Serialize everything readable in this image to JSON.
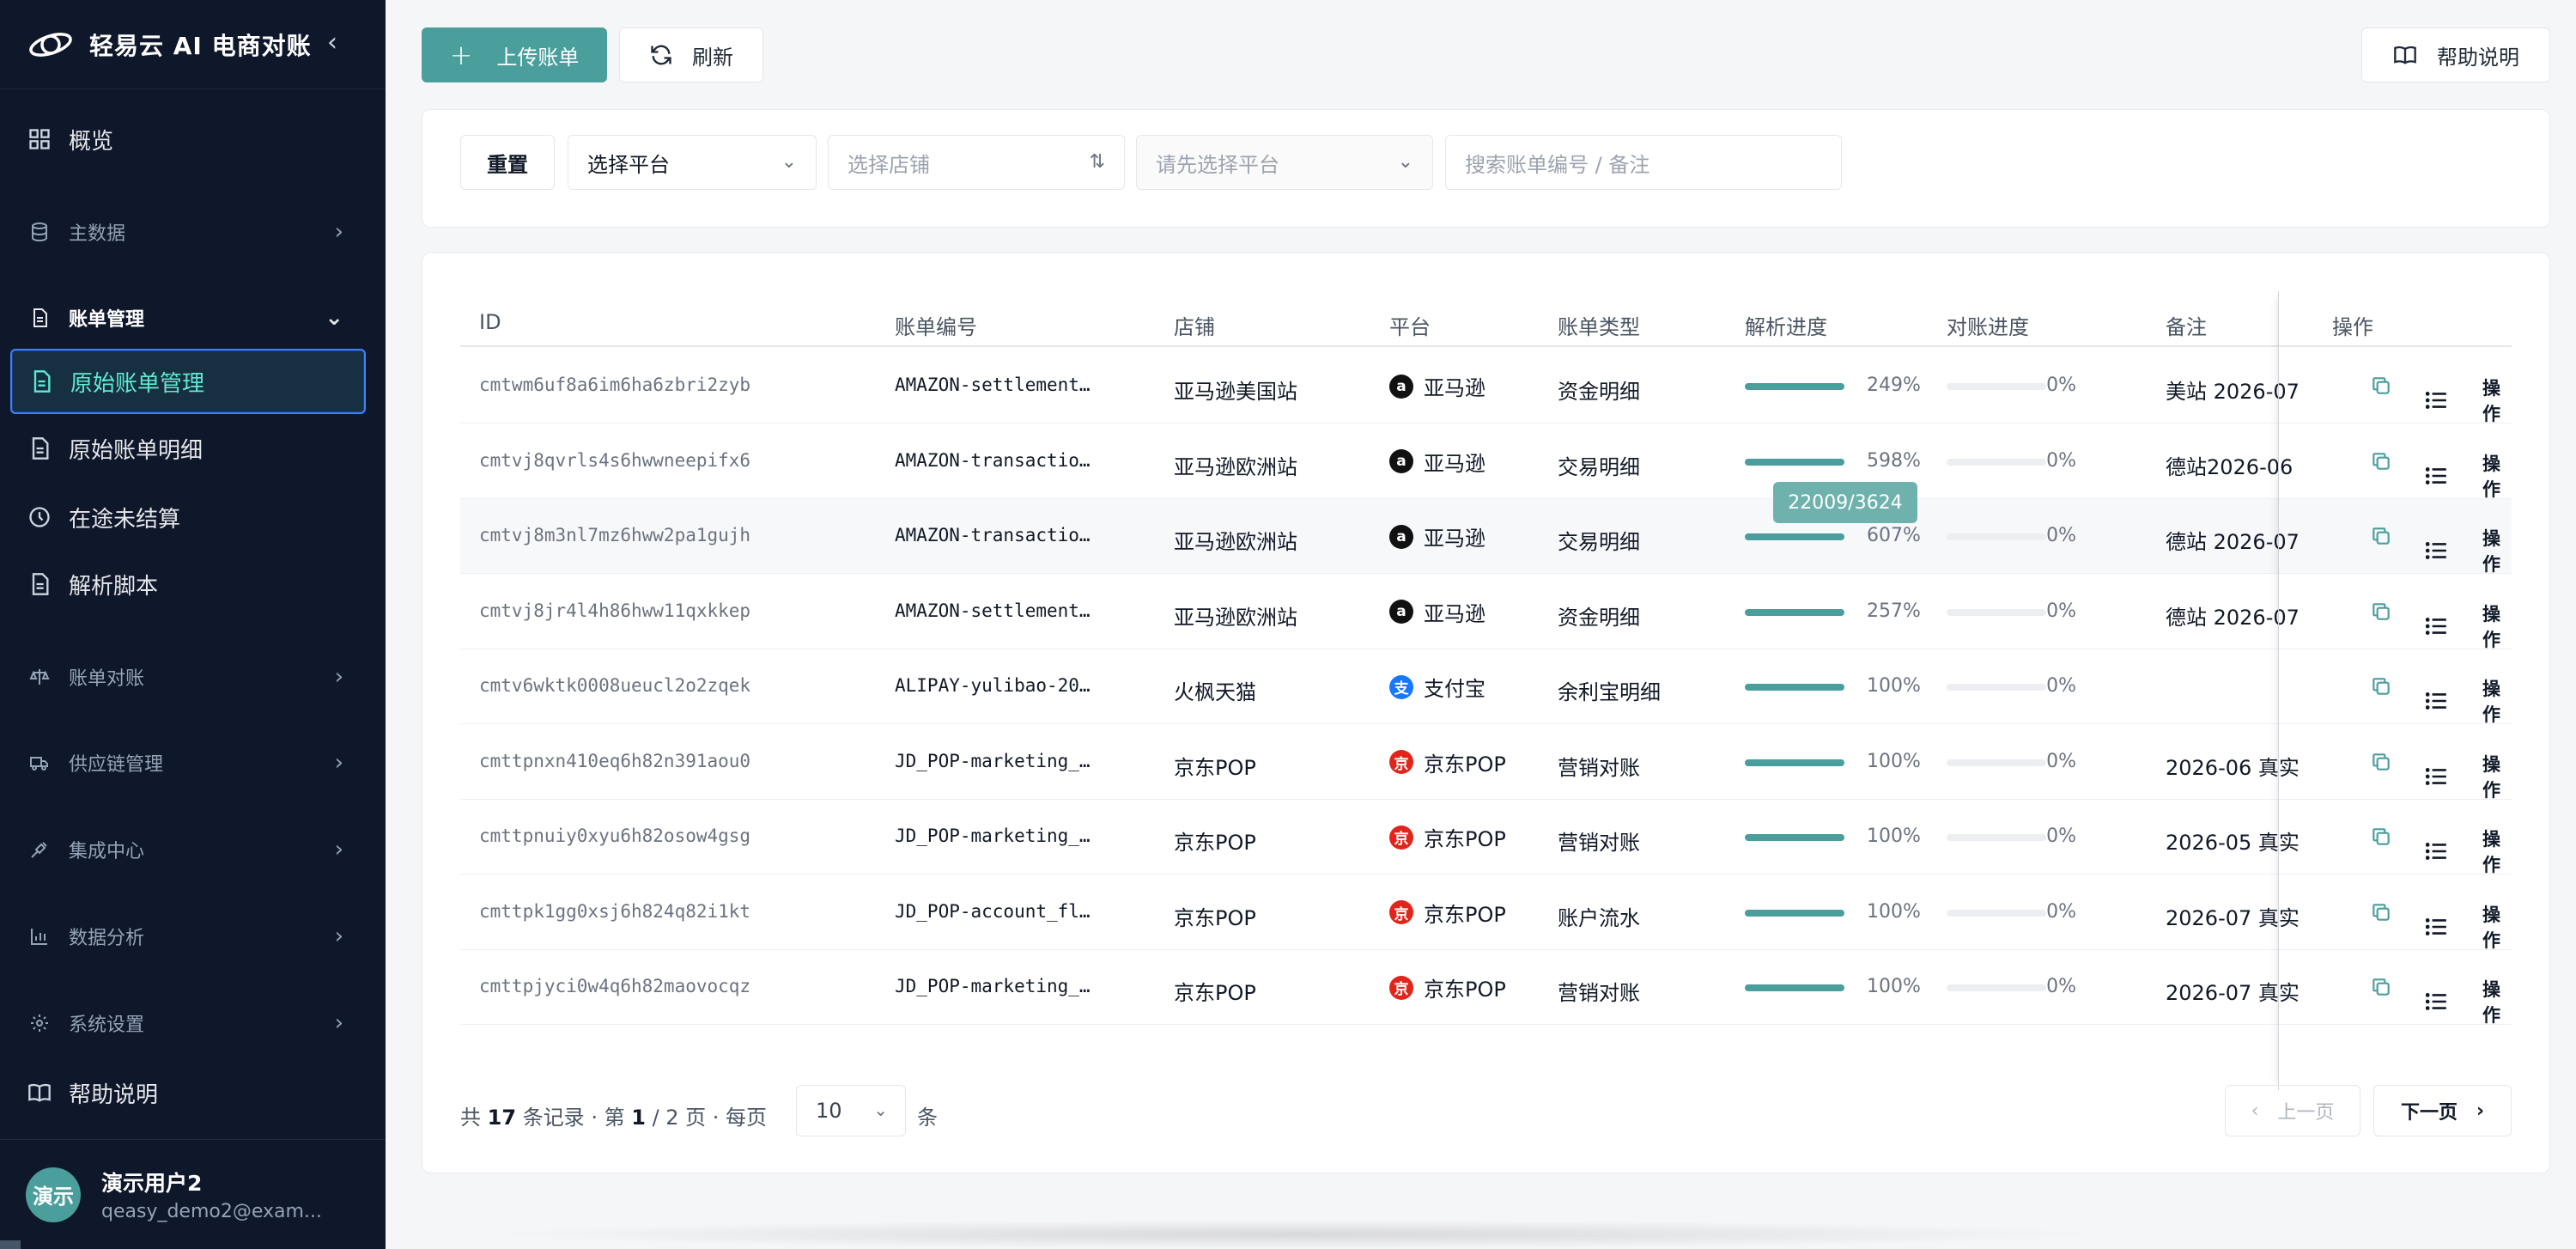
{
  "brand": {
    "title": "轻易云 AI 电商对账",
    "collapse_icon": "chevron-left-icon"
  },
  "nav": {
    "overview": "概览",
    "master_data": "主数据",
    "bill_mgmt": "账单管理",
    "raw_bills": "原始账单管理",
    "raw_details": "原始账单明细",
    "in_transit": "在途未结算",
    "parse_script": "解析脚本",
    "reconcile": "账单对账",
    "supply_chain": "供应链管理",
    "integration": "集成中心",
    "analytics": "数据分析",
    "settings": "系统设置",
    "help": "帮助说明"
  },
  "user": {
    "avatar_text": "演示",
    "name": "演示用户2",
    "email": "qeasy_demo2@exam..."
  },
  "toolbar": {
    "upload": "上传账单",
    "refresh": "刷新",
    "help": "帮助说明"
  },
  "filters": {
    "reset": "重置",
    "platform": "选择平台",
    "shop_placeholder": "选择店铺",
    "sub_placeholder": "请先选择平台",
    "search_placeholder": "搜索账单编号 / 备注"
  },
  "table": {
    "headers": {
      "id": "ID",
      "no": "账单编号",
      "shop": "店铺",
      "platform": "平台",
      "type": "账单类型",
      "parse": "解析进度",
      "reconcile": "对账进度",
      "note": "备注",
      "ops": "操作"
    },
    "op_label": "操作",
    "rows": [
      {
        "id": "cmtwm6uf8a6im6ha6zbri2zyb",
        "no": "AMAZON-settlement…",
        "shop": "亚马逊美国站",
        "platform": "亚马逊",
        "platform_key": "amazon",
        "type": "资金明细",
        "parse_pct": "249%",
        "parse_frac": 1.0,
        "rec_pct": "0%",
        "rec_frac": 0,
        "note": "美站 2026-07"
      },
      {
        "id": "cmtvj8qvrls4s6hwwneepifx6",
        "no": "AMAZON-transactio…",
        "shop": "亚马逊欧洲站",
        "platform": "亚马逊",
        "platform_key": "amazon",
        "type": "交易明细",
        "parse_pct": "598%",
        "parse_frac": 1.0,
        "rec_pct": "0%",
        "rec_frac": 0,
        "note": "德站2026-06"
      },
      {
        "id": "cmtvj8m3nl7mz6hww2pa1gujh",
        "no": "AMAZON-transactio…",
        "shop": "亚马逊欧洲站",
        "platform": "亚马逊",
        "platform_key": "amazon",
        "type": "交易明细",
        "parse_pct": "607%",
        "parse_frac": 1.0,
        "rec_pct": "0%",
        "rec_frac": 0,
        "note": "德站 2026-07"
      },
      {
        "id": "cmtvj8jr4l4h86hww11qxkkep",
        "no": "AMAZON-settlement…",
        "shop": "亚马逊欧洲站",
        "platform": "亚马逊",
        "platform_key": "amazon",
        "type": "资金明细",
        "parse_pct": "257%",
        "parse_frac": 1.0,
        "rec_pct": "0%",
        "rec_frac": 0,
        "note": "德站 2026-07"
      },
      {
        "id": "cmtv6wktk0008ueucl2o2zqek",
        "no": "ALIPAY-yulibao-20…",
        "shop": "火枫天猫",
        "platform": "支付宝",
        "platform_key": "alipay",
        "type": "余利宝明细",
        "parse_pct": "100%",
        "parse_frac": 1.0,
        "rec_pct": "0%",
        "rec_frac": 0,
        "note": ""
      },
      {
        "id": "cmttpnxn410eq6h82n391aou0",
        "no": "JD_POP-marketing_…",
        "shop": "京东POP",
        "platform": "京东POP",
        "platform_key": "jd",
        "type": "营销对账",
        "parse_pct": "100%",
        "parse_frac": 1.0,
        "rec_pct": "0%",
        "rec_frac": 0,
        "note": "2026-06 真实"
      },
      {
        "id": "cmttpnuiy0xyu6h82osow4gsg",
        "no": "JD_POP-marketing_…",
        "shop": "京东POP",
        "platform": "京东POP",
        "platform_key": "jd",
        "type": "营销对账",
        "parse_pct": "100%",
        "parse_frac": 1.0,
        "rec_pct": "0%",
        "rec_frac": 0,
        "note": "2026-05 真实"
      },
      {
        "id": "cmttpk1gg0xsj6h824q82i1kt",
        "no": "JD_POP-account_fl…",
        "shop": "京东POP",
        "platform": "京东POP",
        "platform_key": "jd",
        "type": "账户流水",
        "parse_pct": "100%",
        "parse_frac": 1.0,
        "rec_pct": "0%",
        "rec_frac": 0,
        "note": "2026-07 真实"
      },
      {
        "id": "cmttpjyci0w4q6h82maovocqz",
        "no": "JD_POP-marketing_…",
        "shop": "京东POP",
        "platform": "京东POP",
        "platform_key": "jd",
        "type": "营销对账",
        "parse_pct": "100%",
        "parse_frac": 1.0,
        "rec_pct": "0%",
        "rec_frac": 0,
        "note": "2026-07 真实"
      }
    ]
  },
  "tooltip": "22009/3624",
  "pagination": {
    "prefix": "共",
    "total": "17",
    "mid": "条记录 · 第",
    "page": "1",
    "of": "/ 2 页 · 每页",
    "size": "10",
    "unit": "条",
    "prev": "上一页",
    "next": "下一页"
  },
  "colors": {
    "accent": "#4a9e9c",
    "sidebar_bg": "#0f172a",
    "amazon": "#111111",
    "alipay": "#1677ff",
    "jd": "#e1251b"
  }
}
